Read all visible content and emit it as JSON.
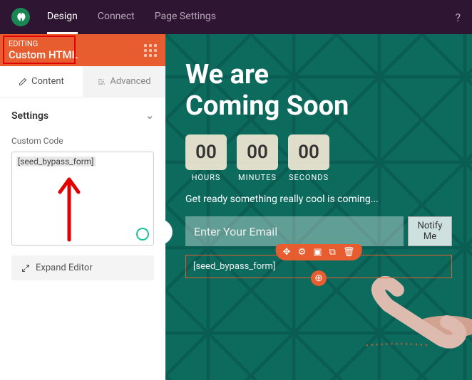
{
  "topbar": {
    "tabs": [
      "Design",
      "Connect",
      "Page Settings"
    ],
    "activeTab": 0
  },
  "editor": {
    "editing_label": "EDITING",
    "block_name": "Custom HTML",
    "subtabs": {
      "content": "Content",
      "advanced": "Advanced"
    },
    "section_title": "Settings",
    "field_label": "Custom Code",
    "code_value": "[seed_bypass_form]",
    "expand_btn": "Expand Editor"
  },
  "preview": {
    "heading_line1": "We are",
    "heading_line2": "Coming Soon",
    "countdown": {
      "hours": {
        "value": "00",
        "label": "HOURS"
      },
      "minutes": {
        "value": "00",
        "label": "MINUTES"
      },
      "seconds": {
        "value": "00",
        "label": "SECONDS"
      }
    },
    "tagline": "Get ready something really cool is coming...",
    "email_placeholder": "Enter Your Email",
    "notify_btn": "Notify Me",
    "shortcode_text": "[seed_bypass_form]"
  }
}
